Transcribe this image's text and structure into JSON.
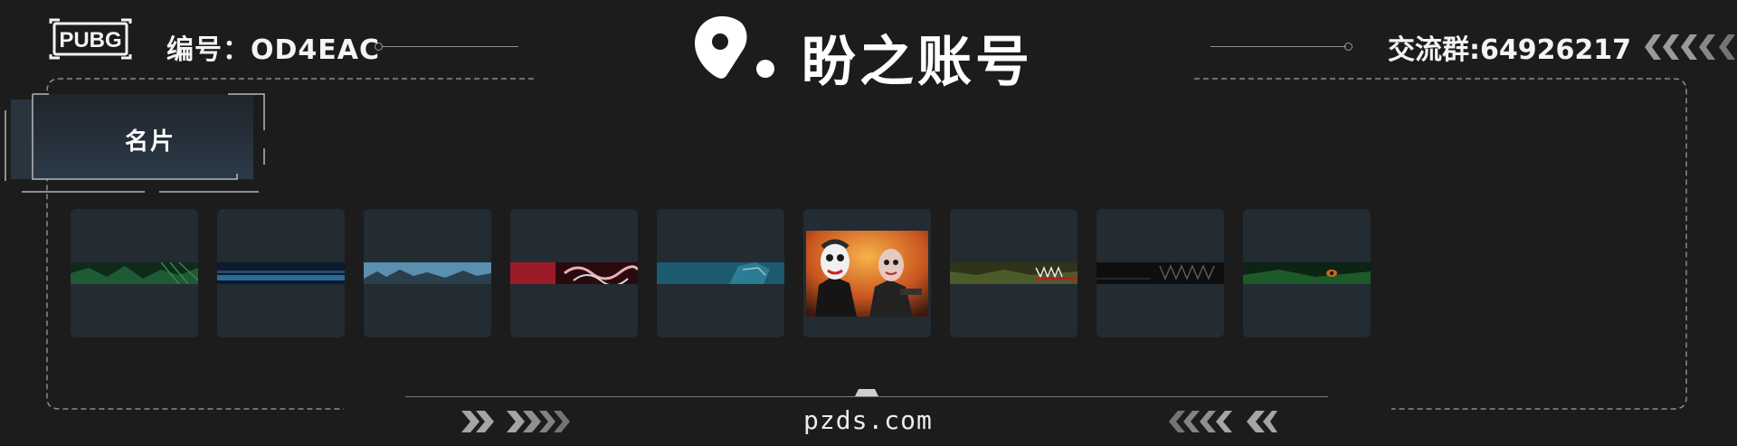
{
  "header": {
    "logo_text": "PUBG",
    "id_label": "编号：OD4EAC",
    "brand_name": "盼之账号",
    "group_label": "交流群:64926217"
  },
  "section": {
    "title": "名片"
  },
  "cards": [
    {
      "name": "green-camo-nameplate",
      "accent": "#1f6b3a"
    },
    {
      "name": "blue-streak-nameplate",
      "accent": "#2a6a9a"
    },
    {
      "name": "mountain-mist-nameplate",
      "accent": "#5a8fae"
    },
    {
      "name": "red-dragon-nameplate",
      "accent": "#9b1c28"
    },
    {
      "name": "teal-beast-nameplate",
      "accent": "#2c7c94"
    },
    {
      "name": "clown-heist-nameplate",
      "accent": "#e07a2a"
    },
    {
      "name": "olive-shark-nameplate",
      "accent": "#4d5a2a"
    },
    {
      "name": "dark-tribal-nameplate",
      "accent": "#2a2a2a"
    },
    {
      "name": "green-eye-nameplate",
      "accent": "#1c5a2a"
    }
  ],
  "footer": {
    "url": "pzds.com"
  },
  "colors": {
    "background": "#1c1c1d",
    "card": "#232b33",
    "frame_dash": "#8a8a8a",
    "chevron": "#9a9a9a"
  }
}
